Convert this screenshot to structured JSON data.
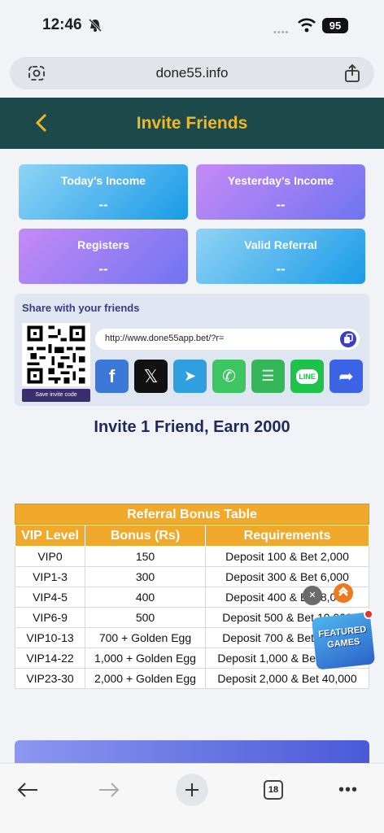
{
  "status_bar": {
    "time": "12:46",
    "battery": "95"
  },
  "browser": {
    "url": "done55.info",
    "tab_count": "18"
  },
  "header": {
    "title": "Invite Friends"
  },
  "cards": [
    {
      "label": "Today's Income",
      "value": "--"
    },
    {
      "label": "Yesterday's Income",
      "value": "--"
    },
    {
      "label": "Registers",
      "value": "--"
    },
    {
      "label": "Valid Referral",
      "value": "--"
    }
  ],
  "share": {
    "title": "Share with your friends",
    "link": "http://www.done55app.bet/?r=",
    "save_label": "Save invite code",
    "socials": [
      {
        "name": "facebook",
        "color": "#3b78d8",
        "glyph": "f"
      },
      {
        "name": "x",
        "color": "#111111",
        "glyph": "𝕏"
      },
      {
        "name": "telegram",
        "color": "#2f9fe0",
        "glyph": "➤"
      },
      {
        "name": "whatsapp",
        "color": "#3cc560",
        "glyph": "✆"
      },
      {
        "name": "sms",
        "color": "#35b658",
        "glyph": "☰"
      },
      {
        "name": "line",
        "color": "#1cc24a",
        "glyph": "LINE"
      },
      {
        "name": "share",
        "color": "#3b63e6",
        "glyph": "➦"
      }
    ]
  },
  "invite_heading": "Invite 1 Friend, Earn 2000",
  "table": {
    "title": "Referral Bonus Table",
    "headers": [
      "VIP Level",
      "Bonus (Rs)",
      "Requirements"
    ],
    "rows": [
      [
        "VIP0",
        "150",
        "Deposit 100 & Bet 2,000"
      ],
      [
        "VIP1-3",
        "300",
        "Deposit 300 & Bet 6,000"
      ],
      [
        "VIP4-5",
        "400",
        "Deposit 400 & Bet 8,000"
      ],
      [
        "VIP6-9",
        "500",
        "Deposit 500 & Bet 10,000"
      ],
      [
        "VIP10-13",
        "700 + Golden Egg",
        "Deposit 700 & Bet 14,000"
      ],
      [
        "VIP14-22",
        "1,000 + Golden Egg",
        "Deposit 1,000 & Bet 20,000"
      ],
      [
        "VIP23-30",
        "2,000 + Golden Egg",
        "Deposit 2,000 & Bet 40,000"
      ]
    ]
  },
  "featured": {
    "label": "FEATURED GAMES"
  },
  "colors": {
    "header_bg": "#1c4a4a",
    "accent": "#f2b823",
    "table_orange": "#f0a92a"
  }
}
